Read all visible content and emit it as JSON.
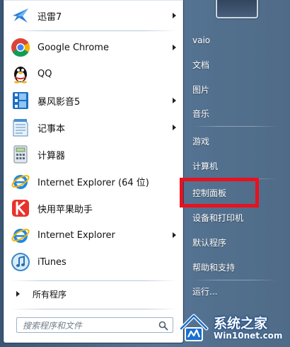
{
  "programs": [
    {
      "label": "迅雷7",
      "icon": "thunder-bird-icon",
      "has_submenu": true
    },
    {
      "label": "Google Chrome",
      "icon": "chrome-icon",
      "has_submenu": true
    },
    {
      "label": "QQ",
      "icon": "qq-penguin-icon",
      "has_submenu": false
    },
    {
      "label": "暴风影音5",
      "icon": "film-icon",
      "has_submenu": true
    },
    {
      "label": "记事本",
      "icon": "notepad-icon",
      "has_submenu": true
    },
    {
      "label": "计算器",
      "icon": "calculator-icon",
      "has_submenu": false
    },
    {
      "label": "Internet Explorer (64 位)",
      "icon": "ie-icon",
      "has_submenu": false
    },
    {
      "label": "快用苹果助手",
      "icon": "kuaiyong-icon",
      "has_submenu": false
    },
    {
      "label": "Internet Explorer",
      "icon": "ie-icon",
      "has_submenu": true
    },
    {
      "label": "iTunes",
      "icon": "itunes-icon",
      "has_submenu": false
    }
  ],
  "all_programs_label": "所有程序",
  "search": {
    "placeholder": "搜索程序和文件"
  },
  "right_items": [
    {
      "label": "vaio"
    },
    {
      "label": "文档"
    },
    {
      "label": "图片"
    },
    {
      "label": "音乐"
    },
    {
      "label": "游戏"
    },
    {
      "label": "计算机"
    },
    {
      "label": "控制面板"
    },
    {
      "label": "设备和打印机"
    },
    {
      "label": "默认程序"
    },
    {
      "label": "帮助和支持"
    },
    {
      "label": "运行..."
    }
  ],
  "highlight_color": "#e8121f",
  "watermark": {
    "title": "系统之家",
    "subtitle": "Win10net.com"
  }
}
